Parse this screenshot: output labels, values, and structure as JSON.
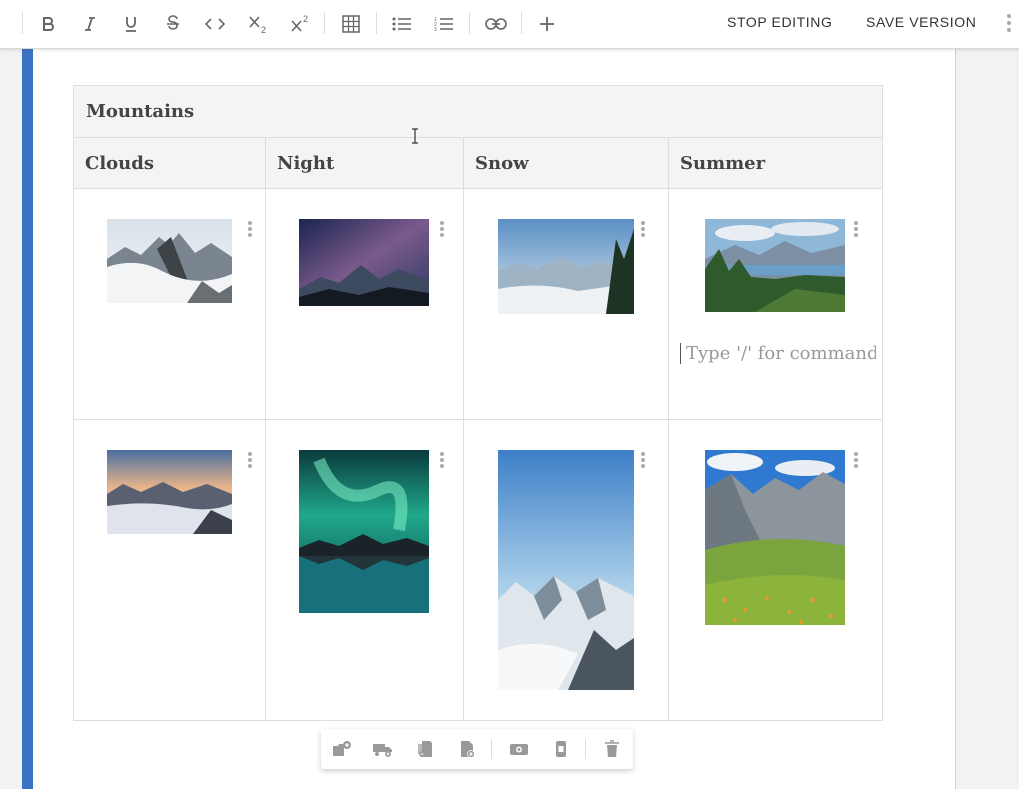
{
  "toolbar": {
    "buttons": [
      "bold",
      "italic",
      "underline",
      "strikethrough",
      "code",
      "subscript",
      "superscript",
      "table",
      "bulleted-list",
      "numbered-list",
      "link",
      "insert"
    ],
    "stop_editing": "STOP EDITING",
    "save_version": "SAVE VERSION"
  },
  "table": {
    "title": "Mountains",
    "columns": [
      "Clouds",
      "Night",
      "Snow",
      "Summer"
    ],
    "placeholder": "Type '/' for command"
  },
  "colors": {
    "accent_bar": "#3b73c4",
    "icon": "#666666"
  },
  "image_toolbar": {
    "icons": [
      "add-image-left-icon",
      "add-image-right-icon",
      "replace-image-icon",
      "add-file-icon",
      "camera-icon",
      "crop-icon",
      "delete-icon"
    ]
  }
}
